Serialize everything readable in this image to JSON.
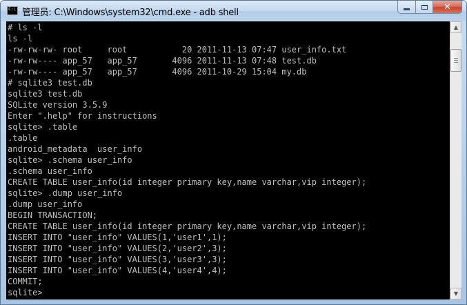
{
  "window": {
    "title": "管理员: C:\\Windows\\system32\\cmd.exe - adb  shell",
    "icon": "cmd-icon",
    "caption_buttons": {
      "minimize": "minimize-icon",
      "maximize": "maximize-icon",
      "close": "✕"
    }
  },
  "console": {
    "background": "#000000",
    "foreground": "#c0c0c0",
    "lines": [
      "# ls -l",
      "ls -l",
      "-rw-rw-rw- root     root           20 2011-11-13 07:47 user_info.txt",
      "-rw-rw---- app_57   app_57       4096 2011-11-13 07:48 test.db",
      "-rw-rw---- app_57   app_57       4096 2011-10-29 15:04 my.db",
      "# sqlite3 test.db",
      "sqlite3 test.db",
      "SQLite version 3.5.9",
      "Enter \".help\" for instructions",
      "sqlite> .table",
      ".table",
      "android_metadata  user_info",
      "sqlite> .schema user_info",
      ".schema user_info",
      "CREATE TABLE user_info(id integer primary key,name varchar,vip integer);",
      "sqlite> .dump user_info",
      ".dump user_info",
      "BEGIN TRANSACTION;",
      "CREATE TABLE user_info(id integer primary key,name varchar,vip integer);",
      "INSERT INTO \"user_info\" VALUES(1,'user1',1);",
      "INSERT INTO \"user_info\" VALUES(2,'user2',3);",
      "INSERT INTO \"user_info\" VALUES(3,'user3',3);",
      "INSERT INTO \"user_info\" VALUES(4,'user4',4);",
      "COMMIT;",
      "sqlite>"
    ]
  },
  "scrollbar": {
    "up_arrow": "▲",
    "down_arrow": "▼"
  }
}
